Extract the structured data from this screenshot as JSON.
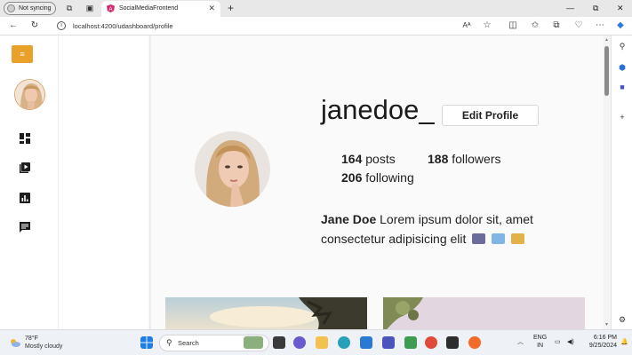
{
  "browser": {
    "profile_label": "Not syncing",
    "tab_title": "SocialMediaFrontend",
    "url": "localhost:4200/udashboard/profile"
  },
  "app": {
    "menu_icon": "menu-icon",
    "nav_icons": [
      "dashboard-icon",
      "video-library-icon",
      "analytics-icon",
      "chat-icon"
    ],
    "accent_color": "#e9a12a"
  },
  "profile": {
    "username": "janedoe_",
    "edit_button": "Edit Profile",
    "posts_count": "164",
    "posts_label": "posts",
    "followers_count": "188",
    "followers_label": "followers",
    "following_count": "206",
    "following_label": "following",
    "display_name": "Jane Doe",
    "bio": "Lorem ipsum dolor sit, amet consectetur adipisicing elit"
  },
  "taskbar": {
    "temperature": "78°F",
    "weather": "Mostly cloudy",
    "search_label": "Search",
    "language": "ENG",
    "region": "IN",
    "time": "6:16 PM",
    "date": "9/25/2024"
  }
}
